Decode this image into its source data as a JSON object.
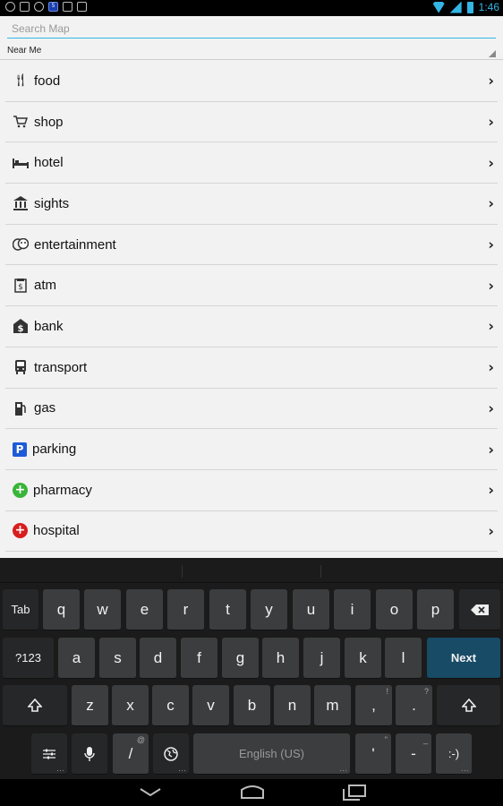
{
  "status_bar": {
    "time": "1:46",
    "notif_badge": "5"
  },
  "search": {
    "placeholder": "Search Map"
  },
  "location_selector": {
    "value": "Near Me"
  },
  "categories": [
    {
      "label": "food",
      "icon": "fork-knife-icon"
    },
    {
      "label": "shop",
      "icon": "shopping-cart-icon"
    },
    {
      "label": "hotel",
      "icon": "bed-icon"
    },
    {
      "label": "sights",
      "icon": "museum-icon"
    },
    {
      "label": "entertainment",
      "icon": "theater-masks-icon"
    },
    {
      "label": "atm",
      "icon": "atm-icon"
    },
    {
      "label": "bank",
      "icon": "bank-icon"
    },
    {
      "label": "transport",
      "icon": "bus-icon"
    },
    {
      "label": "gas",
      "icon": "gas-pump-icon"
    },
    {
      "label": "parking",
      "icon": "parking-icon"
    },
    {
      "label": "pharmacy",
      "icon": "pharmacy-cross-icon"
    },
    {
      "label": "hospital",
      "icon": "hospital-cross-icon"
    }
  ],
  "keyboard": {
    "row1": [
      "Tab",
      "q",
      "w",
      "e",
      "r",
      "t",
      "y",
      "u",
      "i",
      "o",
      "p"
    ],
    "row2": [
      "?123",
      "a",
      "s",
      "d",
      "f",
      "g",
      "h",
      "j",
      "k",
      "l",
      "Next"
    ],
    "row3": [
      "z",
      "x",
      "c",
      "v",
      "b",
      "n",
      "m",
      ",",
      "."
    ],
    "row3_sups": {
      ",": "!",
      ".": "?"
    },
    "row4": {
      "slash": "/",
      "slash_sup": "@",
      "space": "English (US)",
      "apostrophe": "'",
      "apostrophe_sup": "\"",
      "dash": "-",
      "dash_sup": "_",
      "smiley": ":-)"
    }
  },
  "colors": {
    "accent": "#33b5e5",
    "next_key": "#174b66",
    "parking": "#1e5bd8",
    "pharmacy": "#39b43a",
    "hospital": "#d81e1e"
  }
}
